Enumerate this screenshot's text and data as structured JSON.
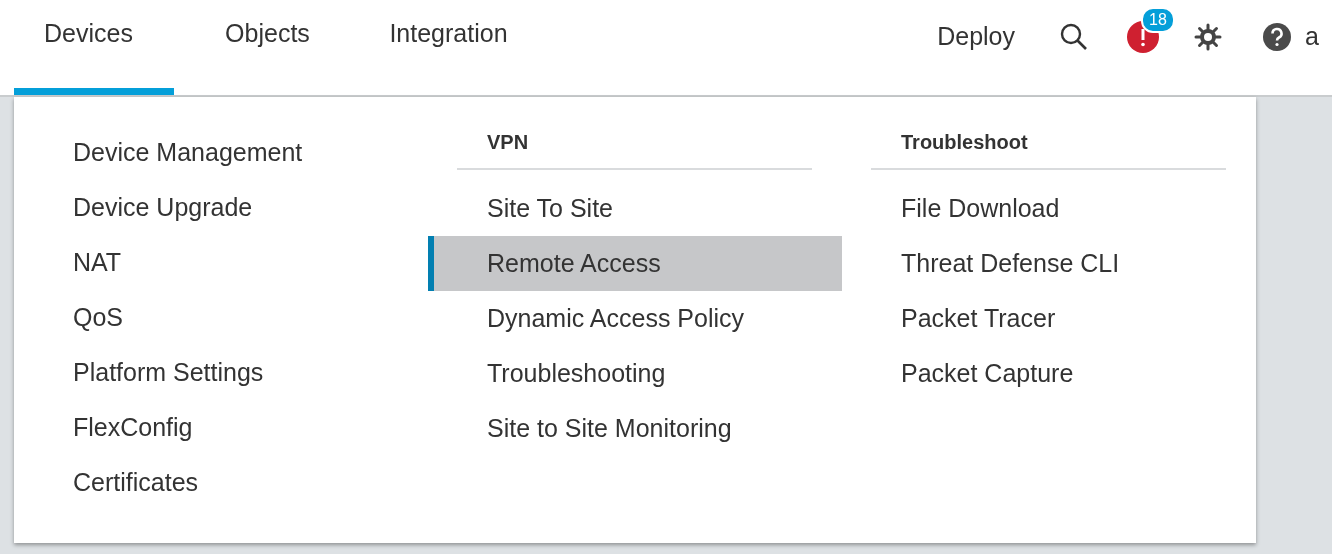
{
  "nav": {
    "tabs": [
      {
        "label": "Devices",
        "selected": true
      },
      {
        "label": "Objects",
        "selected": false
      },
      {
        "label": "Integration",
        "selected": false
      }
    ],
    "deploy": "Deploy",
    "alert_count": "18",
    "user": "a"
  },
  "menu": {
    "columns": [
      {
        "items": [
          {
            "label": "Device Management",
            "selected": false
          },
          {
            "label": "Device Upgrade",
            "selected": false
          },
          {
            "label": "NAT",
            "selected": false
          },
          {
            "label": "QoS",
            "selected": false
          },
          {
            "label": "Platform Settings",
            "selected": false
          },
          {
            "label": "FlexConfig",
            "selected": false
          },
          {
            "label": "Certificates",
            "selected": false
          }
        ]
      },
      {
        "heading": "VPN",
        "items": [
          {
            "label": "Site To Site",
            "selected": false
          },
          {
            "label": "Remote Access",
            "selected": true
          },
          {
            "label": "Dynamic Access Policy",
            "selected": false
          },
          {
            "label": "Troubleshooting",
            "selected": false
          },
          {
            "label": "Site to Site Monitoring",
            "selected": false
          }
        ]
      },
      {
        "heading": "Troubleshoot",
        "items": [
          {
            "label": "File Download",
            "selected": false
          },
          {
            "label": "Threat Defense CLI",
            "selected": false
          },
          {
            "label": "Packet Tracer",
            "selected": false
          },
          {
            "label": "Packet Capture",
            "selected": false
          }
        ]
      }
    ]
  }
}
